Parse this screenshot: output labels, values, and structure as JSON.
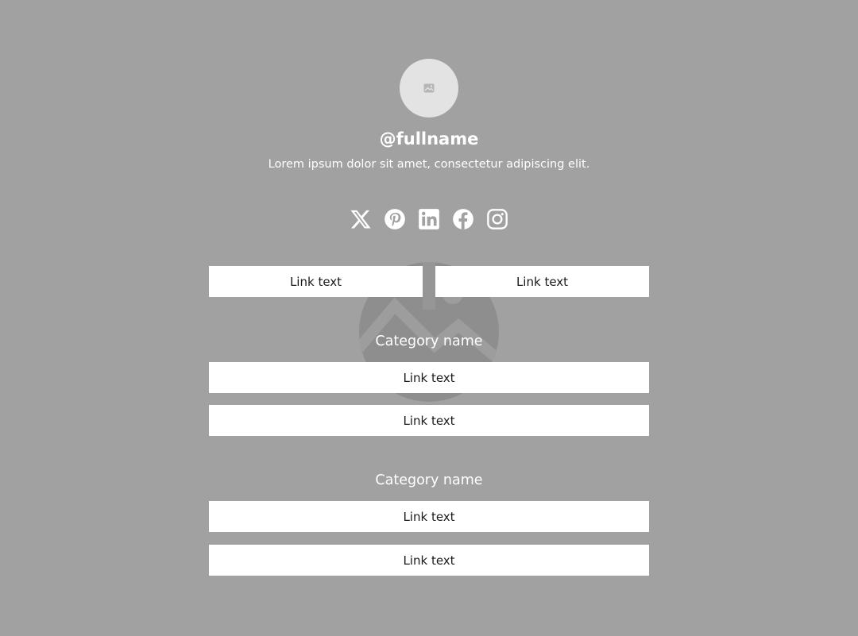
{
  "profile": {
    "username": "@fullname",
    "bio": "Lorem ipsum dolor sit amet, consectetur adipiscing elit."
  },
  "socials": [
    {
      "icon": "x-icon"
    },
    {
      "icon": "pinterest-icon"
    },
    {
      "icon": "linkedin-icon"
    },
    {
      "icon": "facebook-icon"
    },
    {
      "icon": "instagram-icon"
    }
  ],
  "top_links": [
    {
      "label": "Link text"
    },
    {
      "label": "Link text"
    }
  ],
  "categories": [
    {
      "name": "Category name",
      "links": [
        {
          "label": "Link text"
        },
        {
          "label": "Link text"
        }
      ]
    },
    {
      "name": "Category name",
      "links": [
        {
          "label": "Link text"
        },
        {
          "label": "Link text"
        }
      ]
    }
  ],
  "colors": {
    "background": "#a1a1a1",
    "button": "#ffffff",
    "text_on_bg": "#ffffff",
    "avatar": "#e3e3e3"
  }
}
